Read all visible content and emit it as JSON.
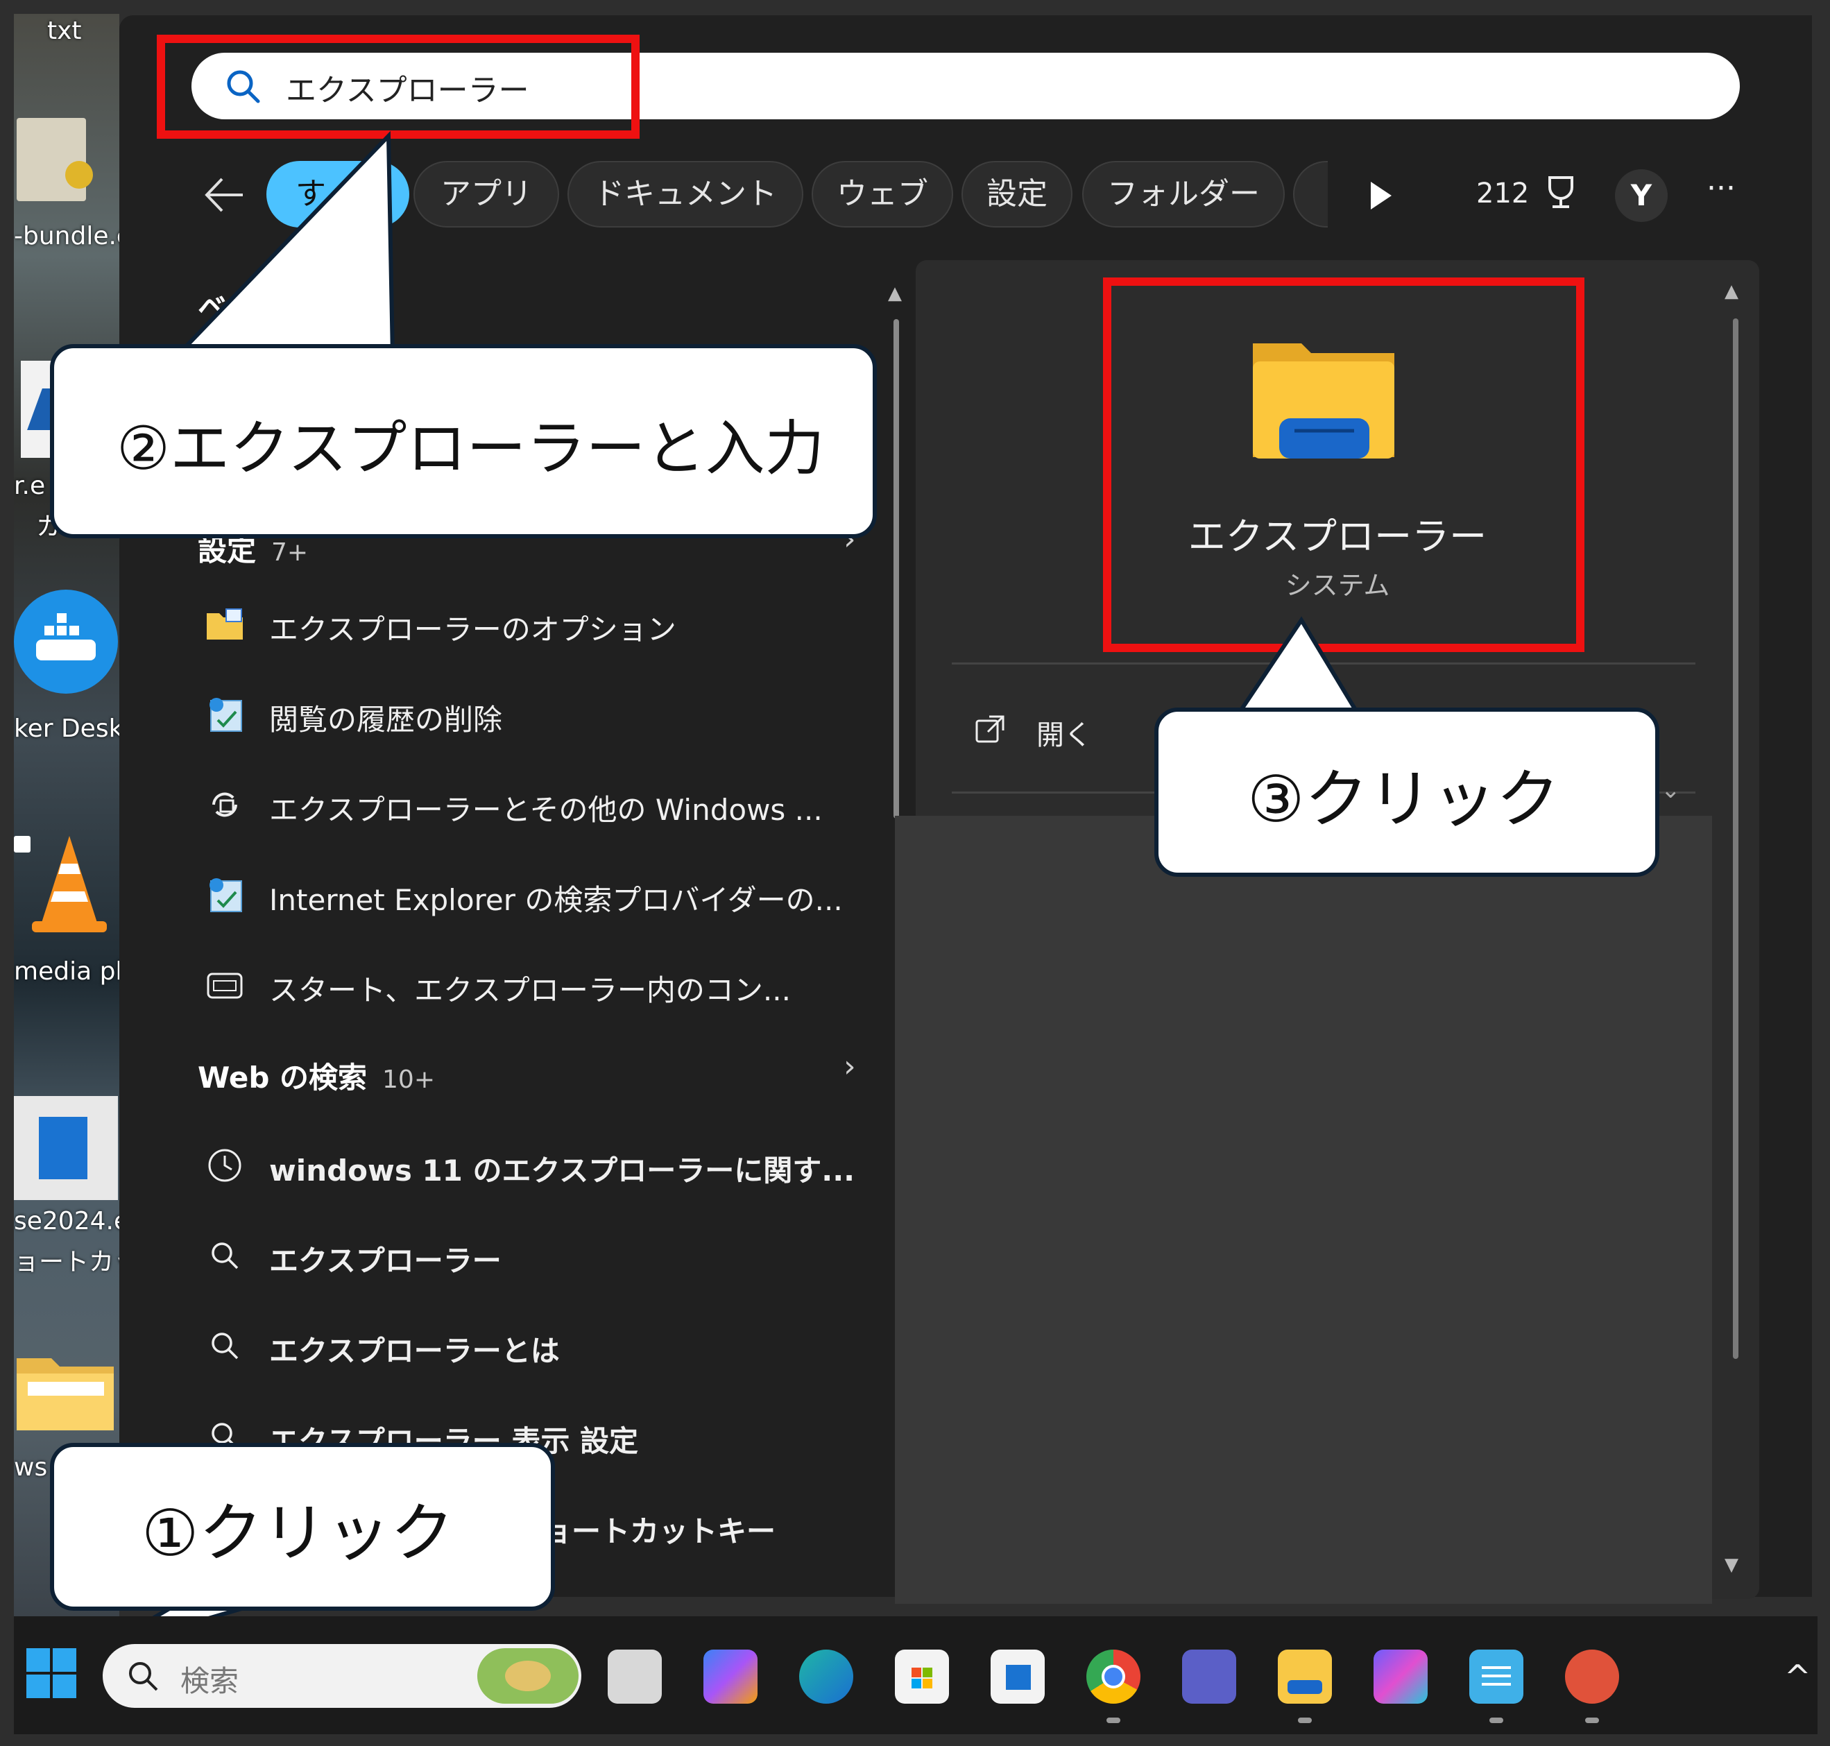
{
  "search": {
    "query": "エクスプローラー"
  },
  "filters": {
    "tabs": [
      {
        "label": "す"
      },
      {
        "label": "アプリ"
      },
      {
        "label": "ドキュメント"
      },
      {
        "label": "ウェブ"
      },
      {
        "label": "設定"
      },
      {
        "label": "フォルダー"
      }
    ],
    "points": "212",
    "avatar": "Y",
    "more": "···"
  },
  "left": {
    "best_match_heading": "ベ",
    "settings": {
      "title": "設定",
      "count": "7+"
    },
    "settings_items": [
      {
        "label": "エクスプローラーのオプション",
        "icon": "folder-options-icon"
      },
      {
        "label": "閲覧の履歴の削除",
        "icon": "internet-options-icon"
      },
      {
        "label": "エクスプローラーとその他の Windows ...",
        "icon": "sync-icon"
      },
      {
        "label": "Internet Explorer の検索プロバイダーの...",
        "icon": "internet-options-icon"
      },
      {
        "label": "スタート、エクスプローラー内のコン...",
        "icon": "keyboard-icon"
      }
    ],
    "web": {
      "title": "Web の検索",
      "count": "10+"
    },
    "web_items": [
      {
        "label": "windows 11 のエクスプローラーに関す...",
        "icon": "history-icon"
      },
      {
        "label": "エクスプローラー",
        "icon": "search-icon"
      },
      {
        "label": "エクスプローラーとは",
        "icon": "search-icon"
      },
      {
        "label": "エクスプローラー 表示 設定",
        "icon": "search-icon"
      },
      {
        "label": "ョートカットキー",
        "icon": "search-icon"
      }
    ]
  },
  "right": {
    "app_name": "エクスプローラー",
    "app_type": "システム",
    "open_label": "開く"
  },
  "callouts": {
    "c1": "①クリック",
    "c2": "②エクスプローラーと入力",
    "c3": "③クリック"
  },
  "desktop": {
    "labels": [
      "txt",
      "-bundle.c",
      "r.e",
      "カ",
      "ker Desk",
      "media pl",
      "se2024.e",
      "ョートカット",
      "ws"
    ]
  },
  "taskbar": {
    "search_placeholder": "検索"
  },
  "colors": {
    "accent": "#4cc2ff",
    "highlight": "#ee1111",
    "panel": "#202020"
  }
}
